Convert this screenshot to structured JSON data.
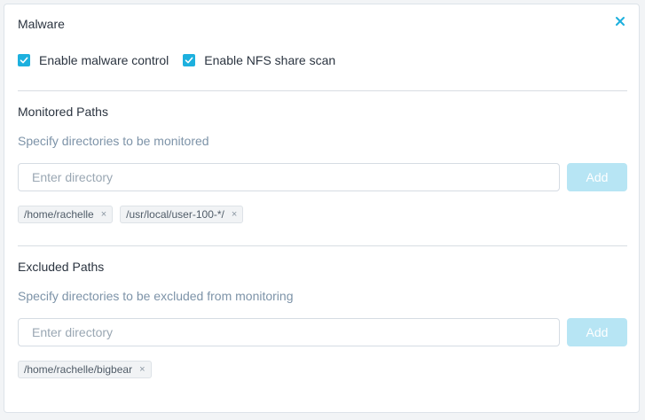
{
  "dialog": {
    "title": "Malware",
    "close_glyph": "×"
  },
  "options": [
    {
      "label": "Enable malware control",
      "checked": true,
      "icon": "checkmark-icon"
    },
    {
      "label": "Enable NFS share scan",
      "checked": true,
      "icon": "checkmark-icon"
    }
  ],
  "monitored": {
    "title": "Monitored Paths",
    "description": "Specify directories to be monitored",
    "input_value": "",
    "input_placeholder": "Enter directory",
    "add_label": "Add",
    "tags": [
      {
        "label": "/home/rachelle",
        "remove": "×"
      },
      {
        "label": "/usr/local/user-100-*/",
        "remove": "×"
      }
    ]
  },
  "excluded": {
    "title": "Excluded Paths",
    "description": "Specify directories to be excluded from monitoring",
    "input_value": "",
    "input_placeholder": "Enter directory",
    "add_label": "Add",
    "tags": [
      {
        "label": "/home/rachelle/bigbear",
        "remove": "×"
      }
    ]
  },
  "colors": {
    "accent": "#1db0de",
    "add_disabled": "#b7e5f4",
    "muted_text": "#7d93a8"
  }
}
